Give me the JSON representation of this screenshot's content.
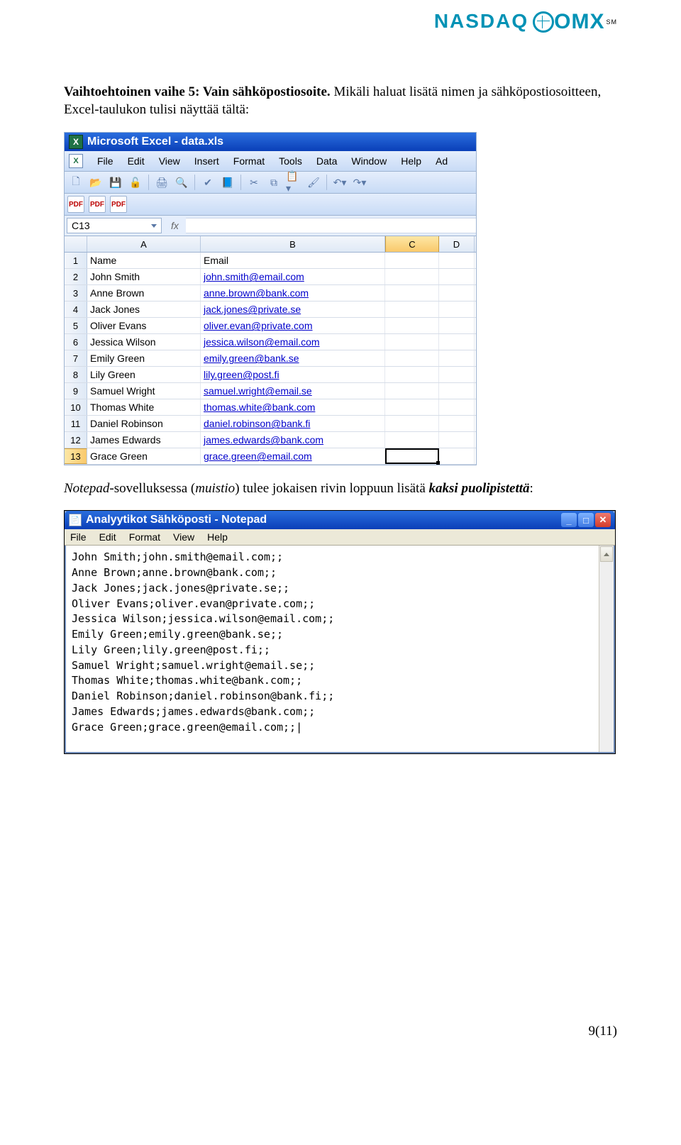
{
  "logo": {
    "nasdaq": "NASDAQ",
    "omx": "OMX",
    "sm": "SM"
  },
  "intro1": {
    "bold": "Vaihtoehtoinen vaihe 5: Vain sähköpostiosoite.",
    "rest": " Mikäli haluat lisätä nimen ja sähköpostiosoitteen, Excel-taulukon tulisi näyttää tältä:"
  },
  "excel": {
    "title": "Microsoft Excel - data.xls",
    "menu": [
      "File",
      "Edit",
      "View",
      "Insert",
      "Format",
      "Tools",
      "Data",
      "Window",
      "Help",
      "Ad"
    ],
    "namebox": "C13",
    "fx_label": "fx",
    "col_headers": [
      "A",
      "B",
      "C",
      "D"
    ],
    "rows": [
      {
        "n": "1",
        "a": "Name",
        "b": "Email",
        "link": false
      },
      {
        "n": "2",
        "a": "John Smith",
        "b": "john.smith@email.com",
        "link": true
      },
      {
        "n": "3",
        "a": "Anne Brown",
        "b": "anne.brown@bank.com",
        "link": true
      },
      {
        "n": "4",
        "a": "Jack Jones",
        "b": "jack.jones@private.se",
        "link": true
      },
      {
        "n": "5",
        "a": "Oliver Evans",
        "b": "oliver.evan@private.com",
        "link": true
      },
      {
        "n": "6",
        "a": "Jessica Wilson",
        "b": "jessica.wilson@email.com",
        "link": true
      },
      {
        "n": "7",
        "a": "Emily Green",
        "b": "emily.green@bank.se",
        "link": true
      },
      {
        "n": "8",
        "a": "Lily Green",
        "b": "lily.green@post.fi",
        "link": true
      },
      {
        "n": "9",
        "a": "Samuel Wright",
        "b": "samuel.wright@email.se",
        "link": true
      },
      {
        "n": "10",
        "a": "Thomas White",
        "b": "thomas.white@bank.com",
        "link": true
      },
      {
        "n": "11",
        "a": "Daniel Robinson",
        "b": "daniel.robinson@bank.fi",
        "link": true
      },
      {
        "n": "12",
        "a": "James Edwards",
        "b": "james.edwards@bank.com",
        "link": true
      },
      {
        "n": "13",
        "a": "Grace Green",
        "b": "grace.green@email.com",
        "link": true,
        "sel": true
      }
    ]
  },
  "notepad_caption": {
    "pre": "Notepad",
    "mid": "-sovelluksessa (",
    "muistio": "muistio",
    "post": ") tulee jokaisen rivin loppuun lisätä ",
    "bold": "kaksi puolipistettä",
    "colon": ":"
  },
  "notepad": {
    "title": "Analyytikot Sähköposti - Notepad",
    "menu": [
      "File",
      "Edit",
      "Format",
      "View",
      "Help"
    ],
    "lines": [
      "John Smith;john.smith@email.com;;",
      "Anne Brown;anne.brown@bank.com;;",
      "Jack Jones;jack.jones@private.se;;",
      "Oliver Evans;oliver.evan@private.com;;",
      "Jessica Wilson;jessica.wilson@email.com;;",
      "Emily Green;emily.green@bank.se;;",
      "Lily Green;lily.green@post.fi;;",
      "Samuel Wright;samuel.wright@email.se;;",
      "Thomas White;thomas.white@bank.com;;",
      "Daniel Robinson;daniel.robinson@bank.fi;;",
      "James Edwards;james.edwards@bank.com;;",
      "Grace Green;grace.green@email.com;;|"
    ]
  },
  "footer": "9(11)"
}
